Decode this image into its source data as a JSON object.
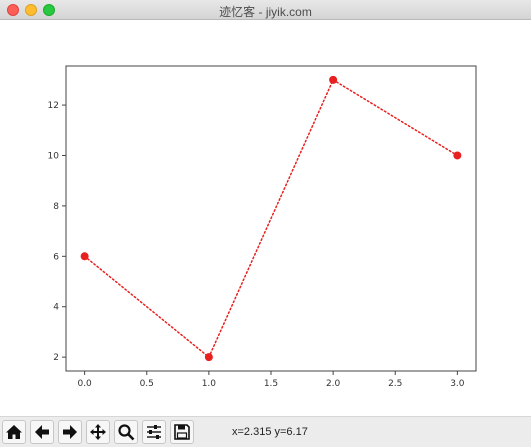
{
  "window": {
    "title": "迹忆客 - jiyik.com"
  },
  "toolbar": {
    "buttons": [
      {
        "name": "home-button",
        "icon": "home-icon"
      },
      {
        "name": "back-button",
        "icon": "arrow-left-icon"
      },
      {
        "name": "forward-button",
        "icon": "arrow-right-icon"
      },
      {
        "name": "pan-button",
        "icon": "move-icon"
      },
      {
        "name": "zoom-button",
        "icon": "magnifier-icon"
      },
      {
        "name": "configure-subplots-button",
        "icon": "sliders-icon"
      },
      {
        "name": "save-button",
        "icon": "floppy-disk-icon"
      }
    ],
    "coordinates": "x=2.315 y=6.17"
  },
  "chart_data": {
    "type": "line",
    "x": [
      0,
      1,
      2,
      3
    ],
    "series": [
      {
        "values": [
          6,
          2,
          13,
          10
        ],
        "color": "#e8201f",
        "linestyle": "dotted",
        "marker": "circle"
      }
    ],
    "xlim": [
      -0.15,
      3.15
    ],
    "ylim": [
      1.45,
      13.55
    ],
    "xticks": [
      "0.0",
      "0.5",
      "1.0",
      "1.5",
      "2.0",
      "2.5",
      "3.0"
    ],
    "yticks": [
      "2",
      "4",
      "6",
      "8",
      "10",
      "12"
    ],
    "title": "",
    "xlabel": "",
    "ylabel": "",
    "grid": false
  }
}
